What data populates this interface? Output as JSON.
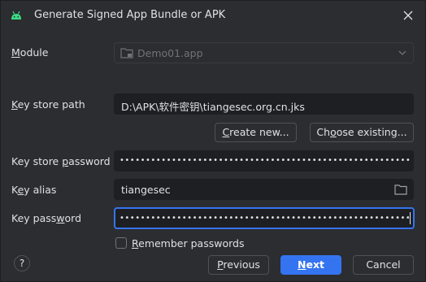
{
  "window": {
    "title": "Generate Signed App Bundle or APK",
    "app_icon": "android-icon",
    "close_icon": "close-icon"
  },
  "module": {
    "label_mnemonic": "M",
    "label_rest": "odule",
    "value": "Demo01.app"
  },
  "keystore": {
    "path_label_mnemonic": "K",
    "path_label_rest": "ey store path",
    "path_value": "D:\\APK\\软件密钥\\tiangesec.org.cn.jks",
    "create_new_prefix": "",
    "create_new_mnemonic": "C",
    "create_new_rest": "reate new...",
    "choose_existing_prefix": "Ch",
    "choose_existing_mnemonic": "o",
    "choose_existing_rest": "ose existing...",
    "password_label": "Key store password",
    "password_label_mnemonic_prefix": "Key store ",
    "password_label_mnemonic": "p",
    "password_label_rest": "assword",
    "password_mask": "••••••••••••••••••••••••••••••••••••••••••••••••••••••••••••••••••••••••••"
  },
  "key": {
    "alias_label_prefix": "K",
    "alias_label_mnemonic": "e",
    "alias_label_rest": "y alias",
    "alias_value": "tiangesec",
    "password_label_prefix": "Key pass",
    "password_label_mnemonic": "w",
    "password_label_rest": "ord",
    "password_mask": "••••••••••••••••••••••••••••••••••••••••••••••••••••••••••••••••••••••••••"
  },
  "remember": {
    "mnemonic": "R",
    "rest": "emember passwords",
    "checked": false
  },
  "footer": {
    "help_label": "?",
    "previous_mnemonic": "P",
    "previous_rest": "revious",
    "next_mnemonic": "N",
    "next_rest": "ext",
    "cancel_label": "Cancel"
  },
  "colors": {
    "background": "#2b2d30",
    "field_dark": "#1e1f22",
    "accent": "#3574f0",
    "text": "#dfe1e5",
    "disabled_text": "#6f737a"
  }
}
